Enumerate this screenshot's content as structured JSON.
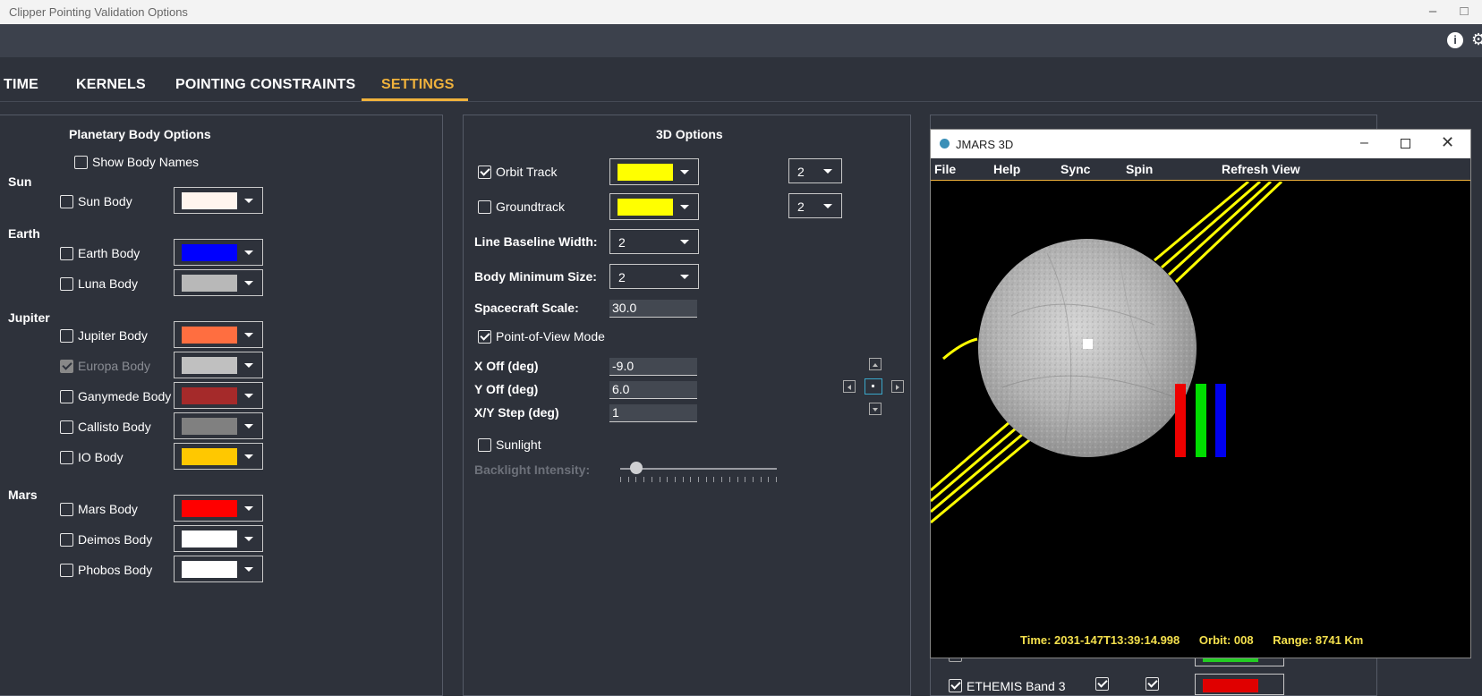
{
  "window": {
    "title": "Clipper Pointing Validation Options",
    "buttons": [
      "minimize",
      "maximize",
      "close"
    ]
  },
  "toolbar": {
    "icons": [
      "info-icon",
      "gear-icon"
    ]
  },
  "tabs": [
    {
      "label": "TIME"
    },
    {
      "label": "KERNELS"
    },
    {
      "label": "POINTING CONSTRAINTS"
    },
    {
      "label": "SETTINGS",
      "active": true
    }
  ],
  "planetary": {
    "title": "Planetary Body Options",
    "show_names": "Show Body Names",
    "groups": [
      {
        "label": "Sun"
      },
      {
        "label": "Earth"
      },
      {
        "label": "Jupiter"
      },
      {
        "label": "Mars"
      }
    ],
    "bodies": [
      {
        "label": "Sun Body",
        "checked": false,
        "color": "#fff5ee"
      },
      {
        "label": "Earth Body",
        "checked": false,
        "color": "#0000ff"
      },
      {
        "label": "Luna Body",
        "checked": false,
        "color": "#b8b8b8"
      },
      {
        "label": "Jupiter Body",
        "checked": false,
        "color": "#ff6e40"
      },
      {
        "label": "Europa Body",
        "checked": true,
        "disabled": true,
        "color": "#c0c0c0"
      },
      {
        "label": "Ganymede Body",
        "checked": false,
        "color": "#a52a2a"
      },
      {
        "label": "Callisto Body",
        "checked": false,
        "color": "#808080"
      },
      {
        "label": "IO Body",
        "checked": false,
        "color": "#ffc800"
      },
      {
        "label": "Mars Body",
        "checked": false,
        "color": "#ff0000"
      },
      {
        "label": "Deimos Body",
        "checked": false,
        "color": "#ffffff"
      },
      {
        "label": "Phobos Body",
        "checked": false,
        "color": "#ffffff"
      }
    ]
  },
  "options3d": {
    "title": "3D Options",
    "orbit_track": {
      "label": "Orbit Track",
      "checked": true,
      "color": "#ffff00",
      "width": "2"
    },
    "groundtrack": {
      "label": "Groundtrack",
      "checked": false,
      "color": "#ffff00",
      "width": "2"
    },
    "line_baseline_width": {
      "label": "Line Baseline Width:",
      "value": "2"
    },
    "body_min_size": {
      "label": "Body Minimum Size:",
      "value": "2"
    },
    "spacecraft_scale": {
      "label": "Spacecraft Scale:",
      "value": "30.0"
    },
    "pov_mode": {
      "label": "Point-of-View Mode",
      "checked": true
    },
    "x_off": {
      "label": "X Off (deg)",
      "value": "-9.0"
    },
    "y_off": {
      "label": "Y Off (deg)",
      "value": "6.0"
    },
    "xy_step": {
      "label": "X/Y Step (deg)",
      "value": "1"
    },
    "sunlight": {
      "label": "Sunlight",
      "checked": false
    },
    "backlight": {
      "label": "Backlight Intensity:",
      "level": 0.1
    }
  },
  "jmars": {
    "title": "JMARS 3D",
    "menu": [
      "File",
      "Help",
      "Sync",
      "Spin",
      "Refresh View"
    ],
    "hud": {
      "time": "Time: 2031-147T13:39:14.998",
      "orbit": "Orbit: 008",
      "range": "Range: 8741 Km"
    }
  },
  "background_panel": {
    "bottom_label": "ETHEMIS Band 3"
  }
}
